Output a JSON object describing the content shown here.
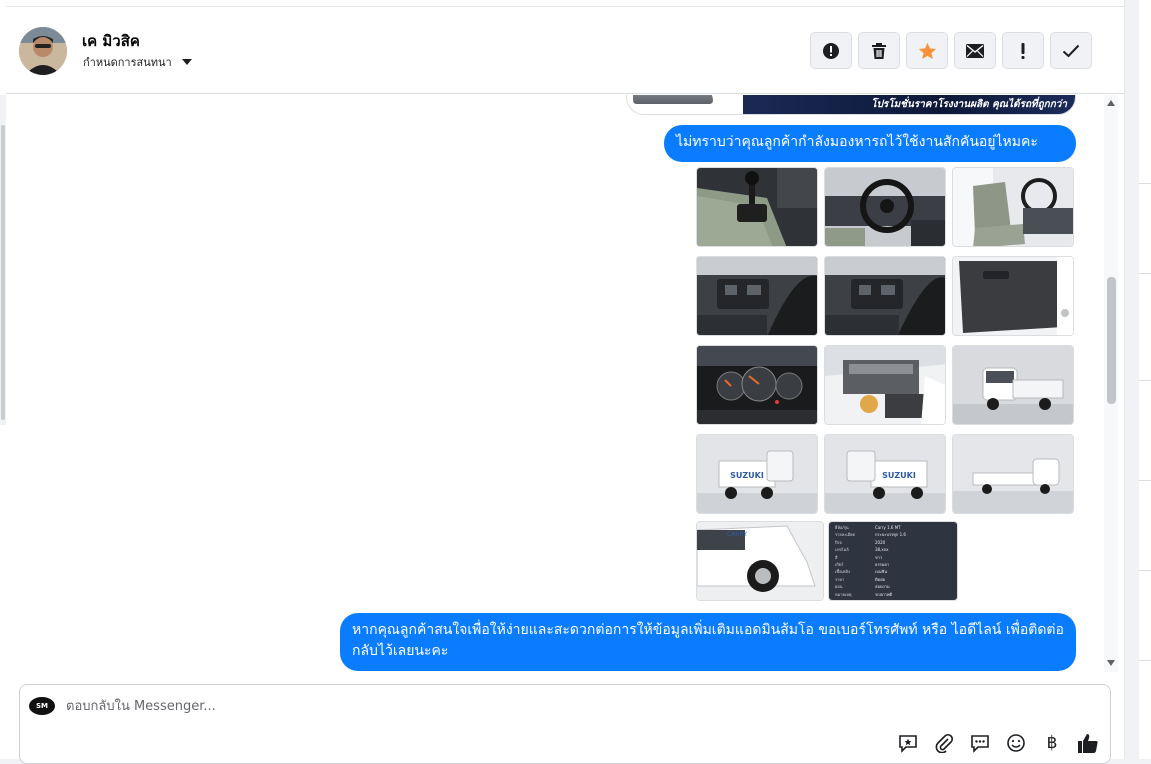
{
  "header": {
    "contact_name": "เค มิวสิค",
    "assign_label": "กำหนดการสนทนา"
  },
  "toolbar": {
    "buttons": [
      {
        "name": "report-icon",
        "label": "Report"
      },
      {
        "name": "trash-icon",
        "label": "Delete"
      },
      {
        "name": "star-icon",
        "label": "Star",
        "color": "#f7923b"
      },
      {
        "name": "envelope-icon",
        "label": "Mark unread"
      },
      {
        "name": "exclamation-icon",
        "label": "Follow up"
      },
      {
        "name": "check-icon",
        "label": "Done"
      }
    ]
  },
  "thread": {
    "previous_card_caption": "โปรโมชั่นราคาโรงงานผลิต คุณได้รถที่ถูกกว่า",
    "messages": [
      {
        "text": "ไม่ทราบว่าคุณลูกค้ากำลังมองหารถไว้ใช้งานสักคันอยู่ไหมคะ"
      },
      {
        "text": "หากคุณลูกค้าสนใจเพื่อให้ง่ายและสะดวกต่อการให้ข้อมูลเพิ่มเติมแอดมินส้มโอ ขอเบอร์โทรศัพท์ หรือ ไอดีไลน์ เพื่อติดต่อกลับไว้เลยนะคะ"
      }
    ],
    "photo_brand": "SUZUKI",
    "spec_sheet": [
      {
        "k": "ยี่ห้อ/รุ่น",
        "v": "Carry 1.6 MT"
      },
      {
        "k": "รายละเอียด",
        "v": "กระบะบรรทุก 1.6"
      },
      {
        "k": "ปีรถ",
        "v": "2020"
      },
      {
        "k": "เลขไมล์",
        "v": "38,xxx"
      },
      {
        "k": "สี",
        "v": "ขาว"
      },
      {
        "k": "เกียร์",
        "v": "ธรรมดา"
      },
      {
        "k": "เชื้อเพลิง",
        "v": "เบนซิน"
      },
      {
        "k": "ราคา",
        "v": "ติดต่อ"
      },
      {
        "k": "ผ่อน",
        "v": "สอบถาม"
      },
      {
        "k": "หมายเหตุ",
        "v": "รถสภาพดี"
      }
    ]
  },
  "composer": {
    "placeholder": "ตอบกลับใน Messenger...",
    "page_avatar_text": "SM",
    "tools": [
      {
        "name": "saved-reply-icon"
      },
      {
        "name": "attach-icon"
      },
      {
        "name": "chat-icon"
      },
      {
        "name": "emoji-icon"
      },
      {
        "name": "baht-icon",
        "glyph": "฿"
      },
      {
        "name": "thumbs-up-icon"
      }
    ]
  },
  "colors": {
    "accent": "#0a7cff",
    "star": "#f7923b"
  }
}
